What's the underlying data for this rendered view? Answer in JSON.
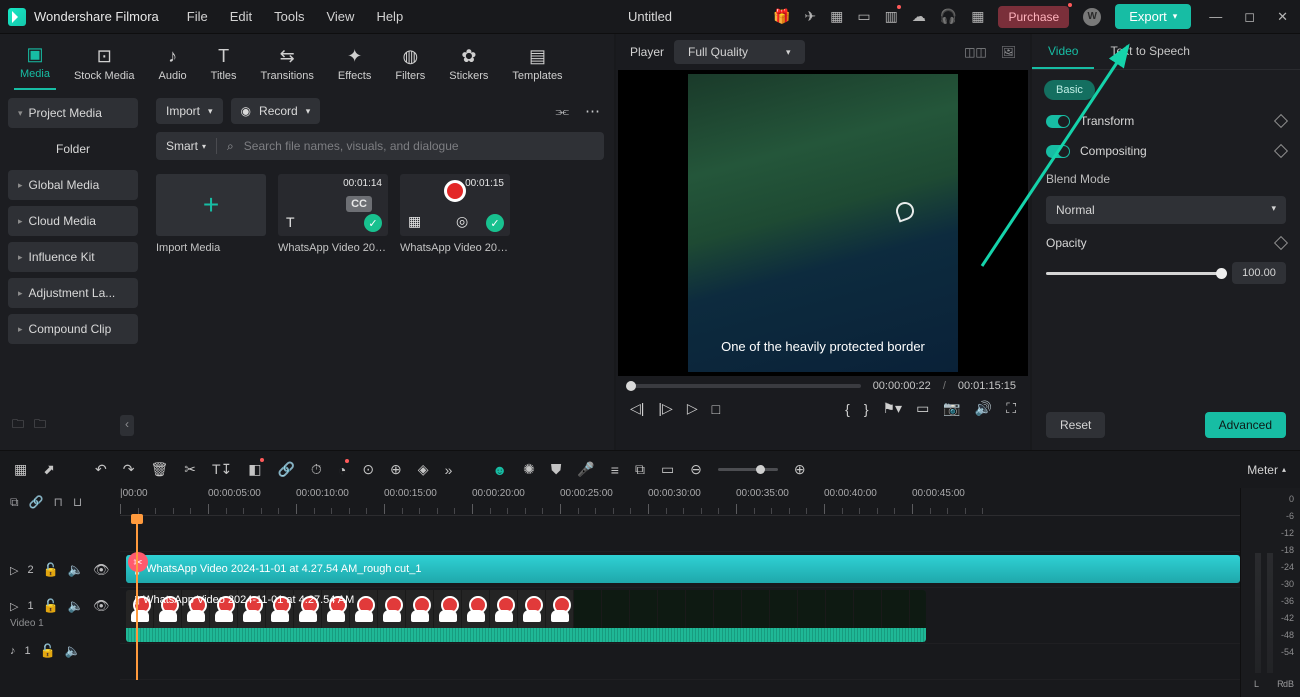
{
  "app": {
    "name": "Wondershare Filmora",
    "doc": "Untitled"
  },
  "menu": {
    "file": "File",
    "edit": "Edit",
    "tools": "Tools",
    "view": "View",
    "help": "Help"
  },
  "titlebar": {
    "purchase": "Purchase",
    "export": "Export",
    "avatar": "W"
  },
  "tabs": {
    "media": "Media",
    "stock": "Stock Media",
    "audio": "Audio",
    "titles": "Titles",
    "transitions": "Transitions",
    "effects": "Effects",
    "filters": "Filters",
    "stickers": "Stickers",
    "templates": "Templates"
  },
  "sidebar": {
    "project": "Project Media",
    "folder": "Folder",
    "global": "Global Media",
    "cloud": "Cloud Media",
    "influence": "Influence Kit",
    "adjust": "Adjustment La...",
    "compound": "Compound Clip"
  },
  "toolbar": {
    "import": "Import",
    "record": "Record",
    "smart": "Smart",
    "search_ph": "Search file names, visuals, and dialogue"
  },
  "thumbs": {
    "import": "Import Media",
    "clip1_dur": "00:01:14",
    "clip1_name": "WhatsApp Video 2024...",
    "clip1_cc": "CC",
    "clip2_dur": "00:01:15",
    "clip2_name": "WhatsApp Video 2024..."
  },
  "player": {
    "label": "Player",
    "quality": "Full Quality",
    "caption": "One of the heavily protected border",
    "current": "00:00:00:22",
    "sep": "/",
    "total": "00:01:15:15"
  },
  "inspector": {
    "video": "Video",
    "tts": "Text to Speech",
    "basic": "Basic",
    "transform": "Transform",
    "compositing": "Compositing",
    "blend": "Blend Mode",
    "blend_val": "Normal",
    "opacity": "Opacity",
    "opacity_val": "100.00",
    "reset": "Reset",
    "advanced": "Advanced"
  },
  "tlbar": {
    "meter": "Meter"
  },
  "ruler": [
    "00:00",
    "00:00:05:00",
    "00:00:10:00",
    "00:00:15:00",
    "00:00:20:00",
    "00:00:25:00",
    "00:00:30:00",
    "00:00:35:00",
    "00:00:40:00",
    "00:00:45:00"
  ],
  "tracks": {
    "t2": "2",
    "t1": "1",
    "v1": "Video 1",
    "a1": "1",
    "clip_text": "WhatsApp Video 2024-11-01 at 4.27.54 AM_rough cut_1",
    "clip_video": "WhatsApp Video 2024-11-01 at 4.27.54 AM"
  },
  "meter": {
    "scale": [
      "0",
      "-6",
      "-12",
      "-18",
      "-24",
      "-30",
      "-36",
      "-42",
      "-48",
      "-54"
    ],
    "lr": "L  R",
    "db": "dB"
  }
}
